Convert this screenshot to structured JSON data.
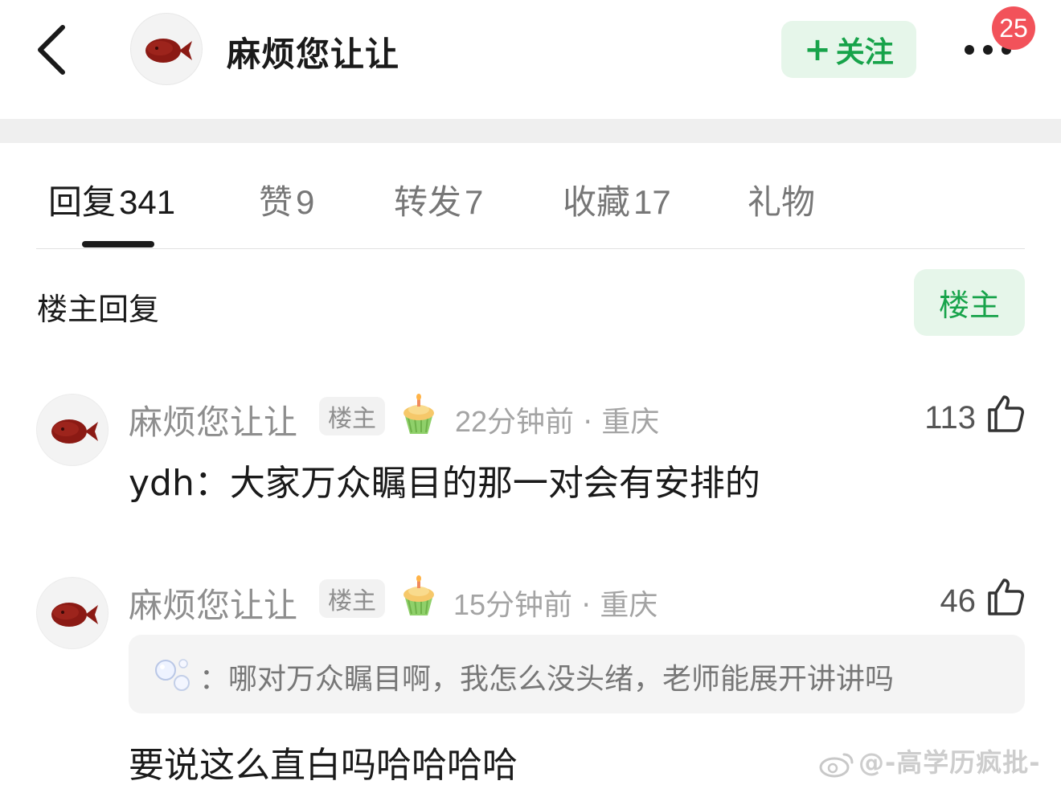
{
  "header": {
    "username": "麻烦您让让",
    "follow_label": "关注",
    "follow_plus": "+",
    "notification_count": "25"
  },
  "tabs": [
    {
      "label": "回复",
      "count": "341"
    },
    {
      "label": "赞",
      "count": "9"
    },
    {
      "label": "转发",
      "count": "7"
    },
    {
      "label": "收藏",
      "count": "17"
    },
    {
      "label": "礼物",
      "count": ""
    }
  ],
  "section": {
    "title": "楼主回复",
    "filter_label": "楼主"
  },
  "comments": [
    {
      "author": "麻烦您让让",
      "tag": "楼主",
      "time": "22分钟前",
      "location": "重庆",
      "likes": "113",
      "text": "ydh：大家万众瞩目的那一对会有安排的"
    },
    {
      "author": "麻烦您让让",
      "tag": "楼主",
      "time": "15分钟前",
      "location": "重庆",
      "likes": "46",
      "quote": "：哪对万众瞩目啊，我怎么没头绪，老师能展开讲讲吗",
      "text": "要说这么直白吗哈哈哈哈"
    }
  ],
  "watermark": "@-高学历疯批-",
  "colors": {
    "accent_green": "#17a34a",
    "green_bg": "#e6f6ea",
    "badge_red": "#f2525a"
  }
}
